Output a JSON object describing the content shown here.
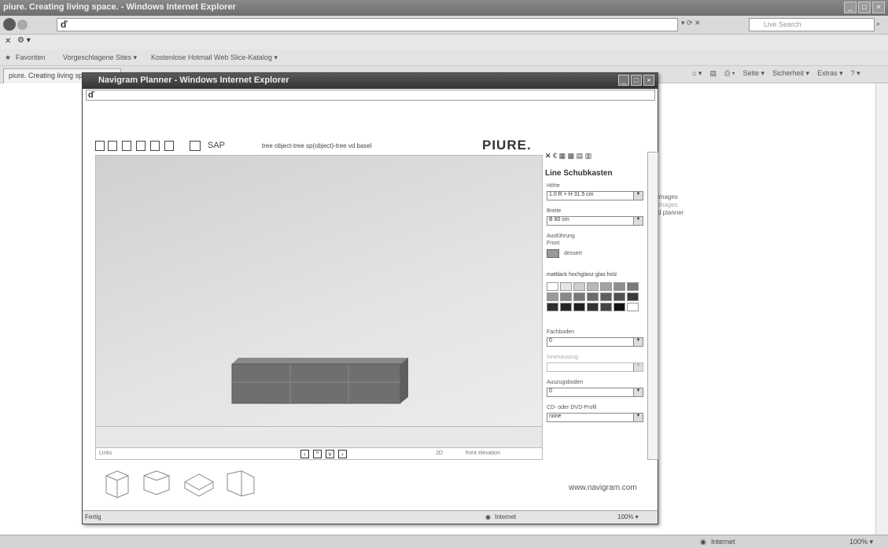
{
  "browser": {
    "title": "piure. Creating living space. - Windows Internet Explorer",
    "address": "ď",
    "search_placeholder": "Live Search",
    "favorites_label": "Favoriten",
    "fav_items": [
      "Vorgeschlagene Sites ▾",
      "Kostenlose Hotmail",
      "Web Slice-Katalog ▾"
    ],
    "tab_label": "piure. Creating living sp...",
    "cmd_items": [
      "Seite ▾",
      "Sicherheit ▾",
      "Extras ▾"
    ],
    "bg_links": [
      "images",
      "images",
      "d planner"
    ],
    "status_zone": "Internet",
    "status_zoom": "100% ▾"
  },
  "popup": {
    "title": "Navigram Planner - Windows Internet Explorer",
    "address": "ď",
    "toolbar": {
      "sap_label": "SAP",
      "tree_links": "tree  object-tree  sp(object)-tree  vd  basel"
    },
    "logo": "PIURE.",
    "panel": {
      "title": "Line Schubkasten",
      "hoehe_label": "Höhe",
      "hoehe_value": "1.0 R + H 31.5 cm",
      "breite_label": "Breite",
      "breite_value": "B 80 cm",
      "ausfuehrung_label": "Ausführung",
      "front_label": "Front",
      "front_value": "dessert",
      "material_tabs": "mattlack  hochglanz  glas  holz",
      "fachboden_label": "Fachboden",
      "fachboden_value": "0",
      "innenauszug_label": "Innenauszug",
      "auszugsboden_label": "Auszugsboden",
      "auszugsboden_value": "0",
      "cd_label": "CD- oder DVD-Profil",
      "cd_value": "none"
    },
    "nav": {
      "left_text": "Links",
      "mode": "2D",
      "right_text": "front elevation"
    },
    "footer_link": "www.navigram.com",
    "status_left": "Fertig",
    "status_zone": "Internet",
    "status_zoom": "100% ▾"
  },
  "colors": {
    "cabinet": "#6f6f6f",
    "swatches": [
      "#ffffff",
      "#e6e6e6",
      "#cfcfcf",
      "#b8b8b8",
      "#a3a3a3",
      "#8f8f8f",
      "#7a7a7a",
      "#9a9a9a",
      "#888888",
      "#777777",
      "#6b6b6b",
      "#5e5e5e",
      "#505050",
      "#3a3a3a",
      "#2e2e2e",
      "#262626",
      "#1f1f1f",
      "#333333",
      "#444444",
      "#111111",
      "#ffffff"
    ]
  }
}
